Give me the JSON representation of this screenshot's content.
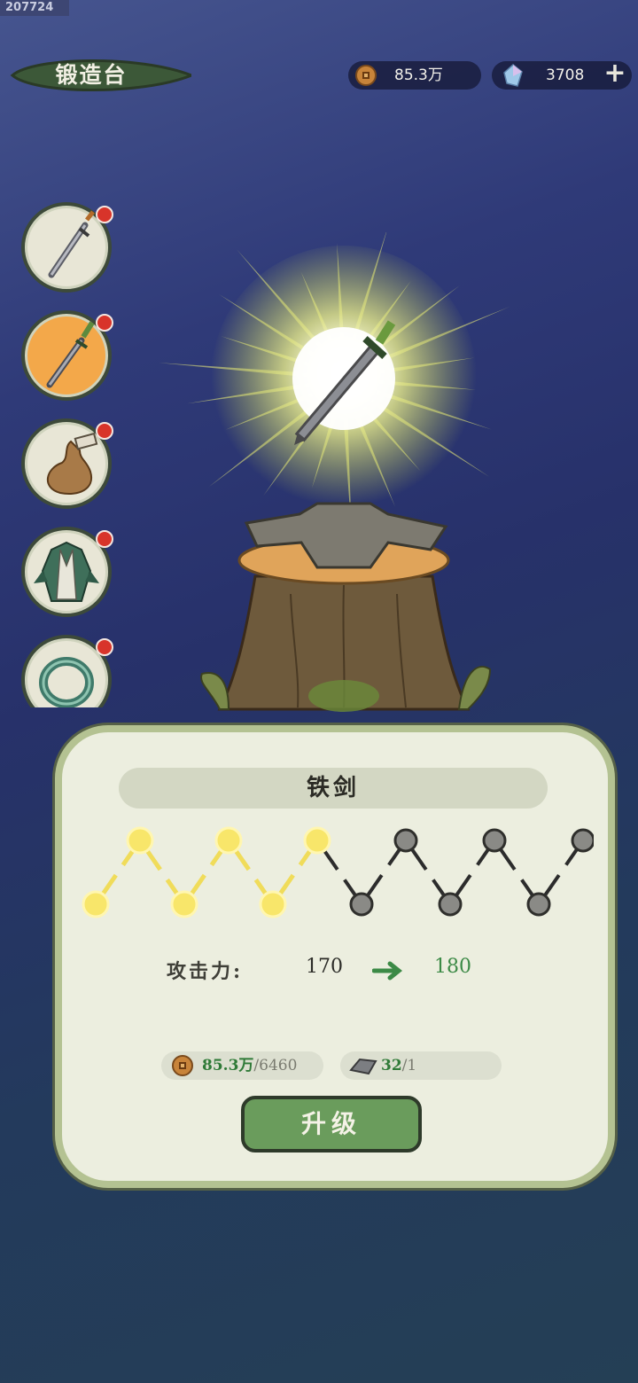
{
  "top_tag": "207724",
  "header": {
    "title": "锻造台"
  },
  "currency": {
    "coins": "85.3万",
    "gems": "3708"
  },
  "sidebar": {
    "items": [
      {
        "name": "sword-icon",
        "active": false
      },
      {
        "name": "green-sword-icon",
        "active": true
      },
      {
        "name": "gourd-icon",
        "active": false
      },
      {
        "name": "armor-icon",
        "active": false
      },
      {
        "name": "bracelet-icon",
        "active": false
      }
    ]
  },
  "item": {
    "name": "铁剑"
  },
  "progress": {
    "filled": 6,
    "total": 12
  },
  "stat": {
    "label": "攻击力:",
    "current": "170",
    "next": "180"
  },
  "cost": {
    "coins_have": "85.3万",
    "coins_need": "/6460",
    "ore_have": "32",
    "ore_need": "/1"
  },
  "button": {
    "upgrade": "升级"
  },
  "colors": {
    "accent": "#6a9c5c",
    "stat_next": "#3c8a46",
    "badge": "#d8342a"
  }
}
